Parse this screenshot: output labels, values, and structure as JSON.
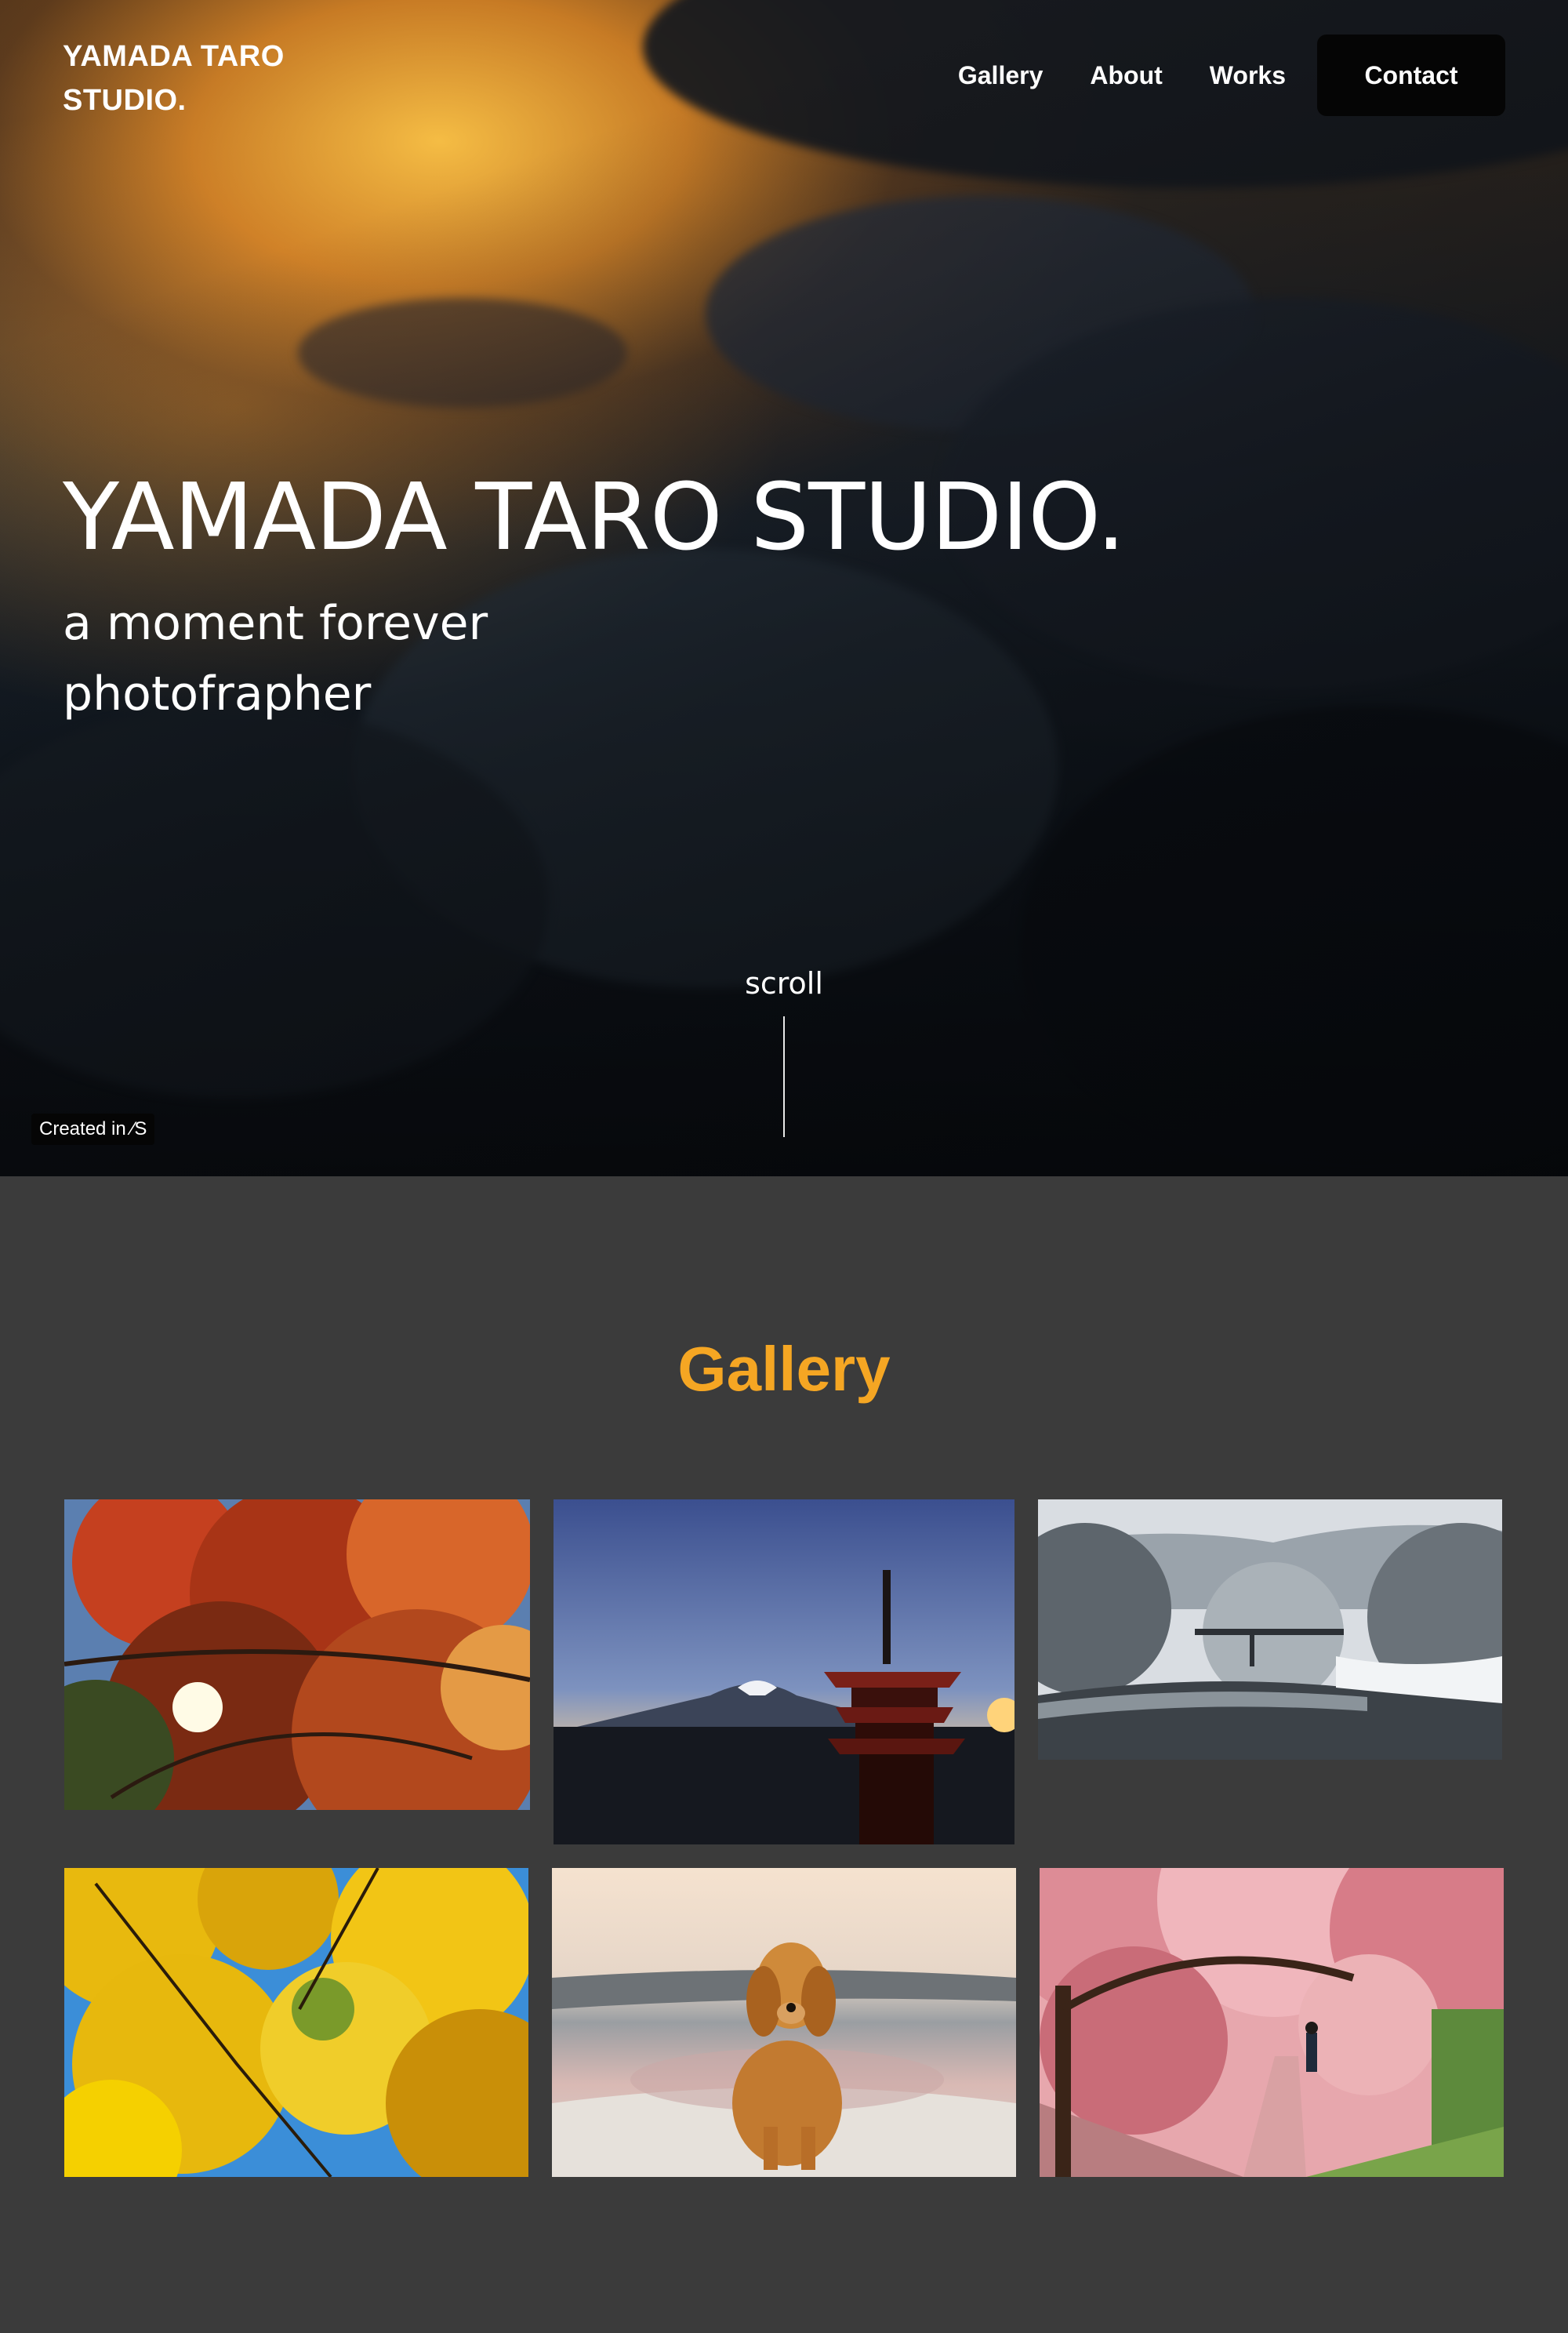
{
  "header": {
    "brand": "YAMADA TARO STUDIO.",
    "nav": [
      {
        "label": "Gallery"
      },
      {
        "label": "About"
      },
      {
        "label": "Works"
      }
    ],
    "contact_label": "Contact"
  },
  "hero": {
    "title": "YAMADA TARO STUDIO.",
    "subtitle": "a moment forever photofrapher",
    "scroll_label": "scroll",
    "badge": "Created in ⁄S"
  },
  "gallery": {
    "title": "Gallery",
    "accent_color": "#f5a623",
    "photos": [
      {
        "subject": "red-maple-leaves-photo"
      },
      {
        "subject": "pagoda-mount-fuji-photo"
      },
      {
        "subject": "snowy-river-bridge-photo"
      },
      {
        "subject": "yellow-ginkgo-leaves-photo"
      },
      {
        "subject": "golden-retriever-beach-photo"
      },
      {
        "subject": "cherry-blossom-path-photo"
      }
    ]
  },
  "colors": {
    "page_background": "#3b3b3b",
    "button_background": "#050505"
  }
}
